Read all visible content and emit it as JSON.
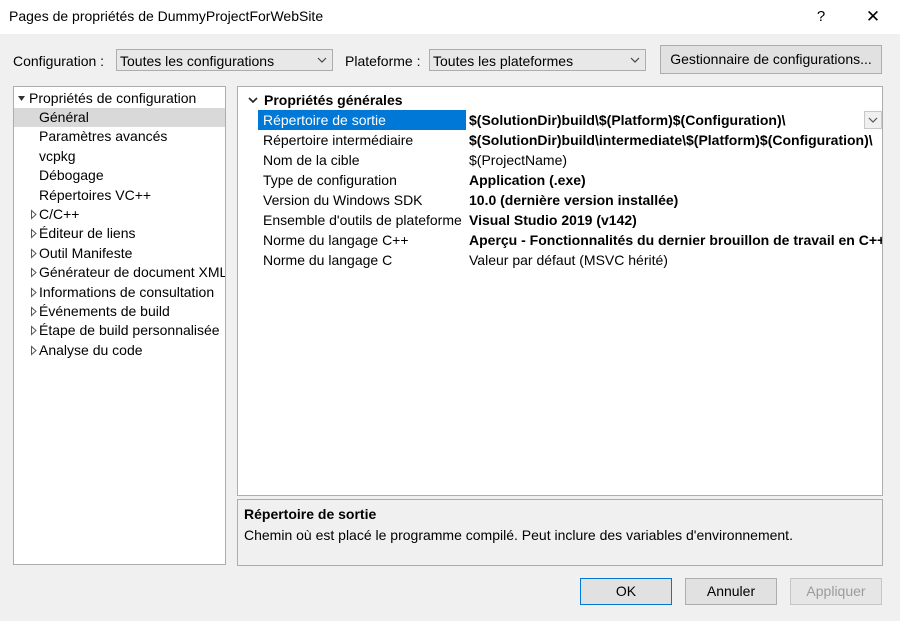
{
  "window": {
    "title": "Pages de propriétés de DummyProjectForWebSite",
    "help_label": "?",
    "close_label": "✕"
  },
  "toolbar": {
    "configuration_label": "Configuration :",
    "configuration_value": "Toutes les configurations",
    "platform_label": "Plateforme :",
    "platform_value": "Toutes les plateformes",
    "config_manager_label": "Gestionnaire de configurations..."
  },
  "tree": {
    "root": "Propriétés de configuration",
    "items": [
      {
        "label": "Général",
        "expandable": false,
        "selected": true
      },
      {
        "label": "Paramètres avancés",
        "expandable": false
      },
      {
        "label": "vcpkg",
        "expandable": false
      },
      {
        "label": "Débogage",
        "expandable": false
      },
      {
        "label": "Répertoires VC++",
        "expandable": false
      },
      {
        "label": "C/C++",
        "expandable": true
      },
      {
        "label": "Éditeur de liens",
        "expandable": true
      },
      {
        "label": "Outil Manifeste",
        "expandable": true
      },
      {
        "label": "Générateur de document XML",
        "expandable": true
      },
      {
        "label": "Informations de consultation",
        "expandable": true
      },
      {
        "label": "Événements de build",
        "expandable": true
      },
      {
        "label": "Étape de build personnalisée",
        "expandable": true
      },
      {
        "label": "Analyse du code",
        "expandable": true
      }
    ]
  },
  "grid": {
    "category": "Propriétés générales",
    "rows": [
      {
        "name": "Répertoire de sortie",
        "value": "$(SolutionDir)build\\$(Platform)$(Configuration)\\",
        "bold": true,
        "selected": true
      },
      {
        "name": "Répertoire intermédiaire",
        "value": "$(SolutionDir)build\\intermediate\\$(Platform)$(Configuration)\\",
        "bold": true
      },
      {
        "name": "Nom de la cible",
        "value": "$(ProjectName)",
        "bold": false
      },
      {
        "name": "Type de configuration",
        "value": "Application (.exe)",
        "bold": true
      },
      {
        "name": "Version du Windows SDK",
        "value": "10.0 (dernière version installée)",
        "bold": true
      },
      {
        "name": "Ensemble d'outils de plateforme",
        "value": "Visual Studio 2019 (v142)",
        "bold": true
      },
      {
        "name": "Norme du langage C++",
        "value": "Aperçu - Fonctionnalités du dernier brouillon de travail en C++",
        "bold": true
      },
      {
        "name": "Norme du langage C",
        "value": "Valeur par défaut (MSVC hérité)",
        "bold": false
      }
    ]
  },
  "description": {
    "title": "Répertoire de sortie",
    "text": "Chemin où est placé le programme compilé. Peut inclure des variables d'environnement."
  },
  "buttons": {
    "ok": "OK",
    "cancel": "Annuler",
    "apply": "Appliquer"
  },
  "colors": {
    "selection": "#0078d7",
    "tree_selection": "#d9d9d9",
    "window_bg": "#f0f0f0"
  }
}
